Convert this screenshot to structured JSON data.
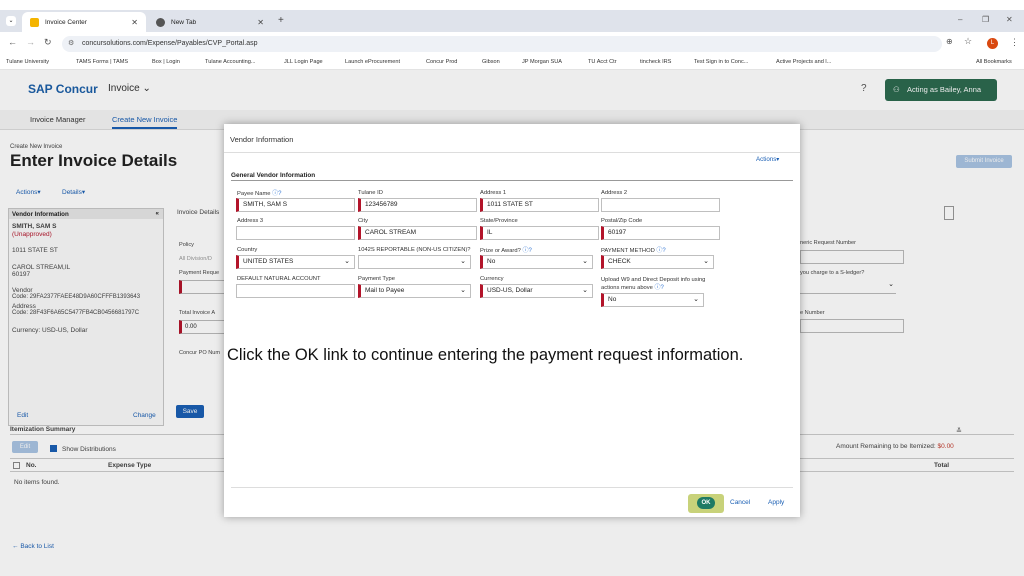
{
  "browser": {
    "tabs": [
      {
        "label": "Invoice Center"
      },
      {
        "label": "New Tab"
      }
    ],
    "url": "concursolutions.com/Expense/Payables/CVP_Portal.asp",
    "bookmarks": [
      "Tulane University",
      "TAMS Forms | TAMS",
      "Box | Login",
      "Tulane Accounting...",
      "JLL Login Page",
      "Launch eProcurement",
      "Concur Prod",
      "Gibson",
      "JP Morgan SUA",
      "TU Acct Ctr",
      "tincheck IRS",
      "Test Sign in to Conc...",
      "Active Projects and l...",
      "All Bookmarks"
    ],
    "profile_initial": "L"
  },
  "app": {
    "logo": "SAP Concur",
    "module": "Invoice",
    "acting_as": "Acting as Bailey, Anna",
    "nav": [
      "Invoice Manager",
      "Create New Invoice"
    ]
  },
  "page": {
    "breadcrumb": "Create New Invoice",
    "title": "Enter Invoice Details",
    "actions": "Actions",
    "details": "Details",
    "submit": "Submit Invoice",
    "vendor_panel": {
      "header": "Vendor Information",
      "name": "SMITH, SAM S",
      "status": "(Unapproved)",
      "street": "1011 STATE ST",
      "city": "CAROL STREAM,IL",
      "zip": "60197",
      "vendor_label": "Vendor",
      "vendor_code": "Code: 29FA2377FAEE48D9A60CFFFB1393643",
      "address_label": "Address",
      "address_code": "Code: 28F43F6A65C5477FB4CB0456681797C",
      "currency": "Currency: USD-US, Dollar",
      "edit": "Edit",
      "change": "Change"
    },
    "invoice_details": "Invoice Details",
    "policy": "Policy",
    "policy_val": "All Division/D",
    "payment_req": "Payment Reque",
    "total_invoice": "Total Invoice A",
    "total_val": "0.00",
    "concur_po": "Concur PO Num",
    "save": "Save",
    "right_label1": "neric Request Number",
    "right_label2": "you charge to a S-ledger?",
    "right_label3": "e Number",
    "itemization": "Itemization Summary",
    "edit_btn": "Edit",
    "show_dist": "Show Distributions",
    "col_no": "No.",
    "col_type": "Expense Type",
    "col_total": "Total",
    "no_items": "No items found.",
    "amount_remaining": "Amount Remaining to be Itemized:",
    "amount_value": "$0.00",
    "back": "Back to List"
  },
  "modal": {
    "title": "Vendor Information",
    "actions": "Actions",
    "section": "General Vendor Information",
    "fields": {
      "payee_name": {
        "label": "Payee Name",
        "value": "SMITH, SAM S"
      },
      "tulane_id": {
        "label": "Tulane ID",
        "value": "123456789"
      },
      "address1": {
        "label": "Address 1",
        "value": "1011 STATE ST"
      },
      "address2": {
        "label": "Address 2",
        "value": ""
      },
      "address3": {
        "label": "Address 3",
        "value": ""
      },
      "city": {
        "label": "City",
        "value": "CAROL STREAM"
      },
      "state": {
        "label": "State/Province",
        "value": "IL"
      },
      "zip": {
        "label": "Postal/Zip Code",
        "value": "60197"
      },
      "country": {
        "label": "Country",
        "value": "UNITED STATES"
      },
      "reportable": {
        "label": "1042S REPORTABLE (NON-US CITIZEN)?",
        "value": ""
      },
      "prize": {
        "label": "Prize or Award?",
        "value": "No"
      },
      "payment_method": {
        "label": "PAYMENT METHOD",
        "value": "CHECK"
      },
      "natural_account": {
        "label": "DEFAULT NATURAL ACCOUNT",
        "value": ""
      },
      "payment_type": {
        "label": "Payment Type",
        "value": "Mail to Payee"
      },
      "currency": {
        "label": "Currency",
        "value": "USD-US, Dollar"
      },
      "upload_w9": {
        "label": "Upload W9 and Direct Deposit info using actions menu above",
        "value": "No"
      }
    },
    "instruction": "Click  the OK link to continue entering the payment request information.",
    "ok": "OK",
    "cancel": "Cancel",
    "apply": "Apply"
  }
}
